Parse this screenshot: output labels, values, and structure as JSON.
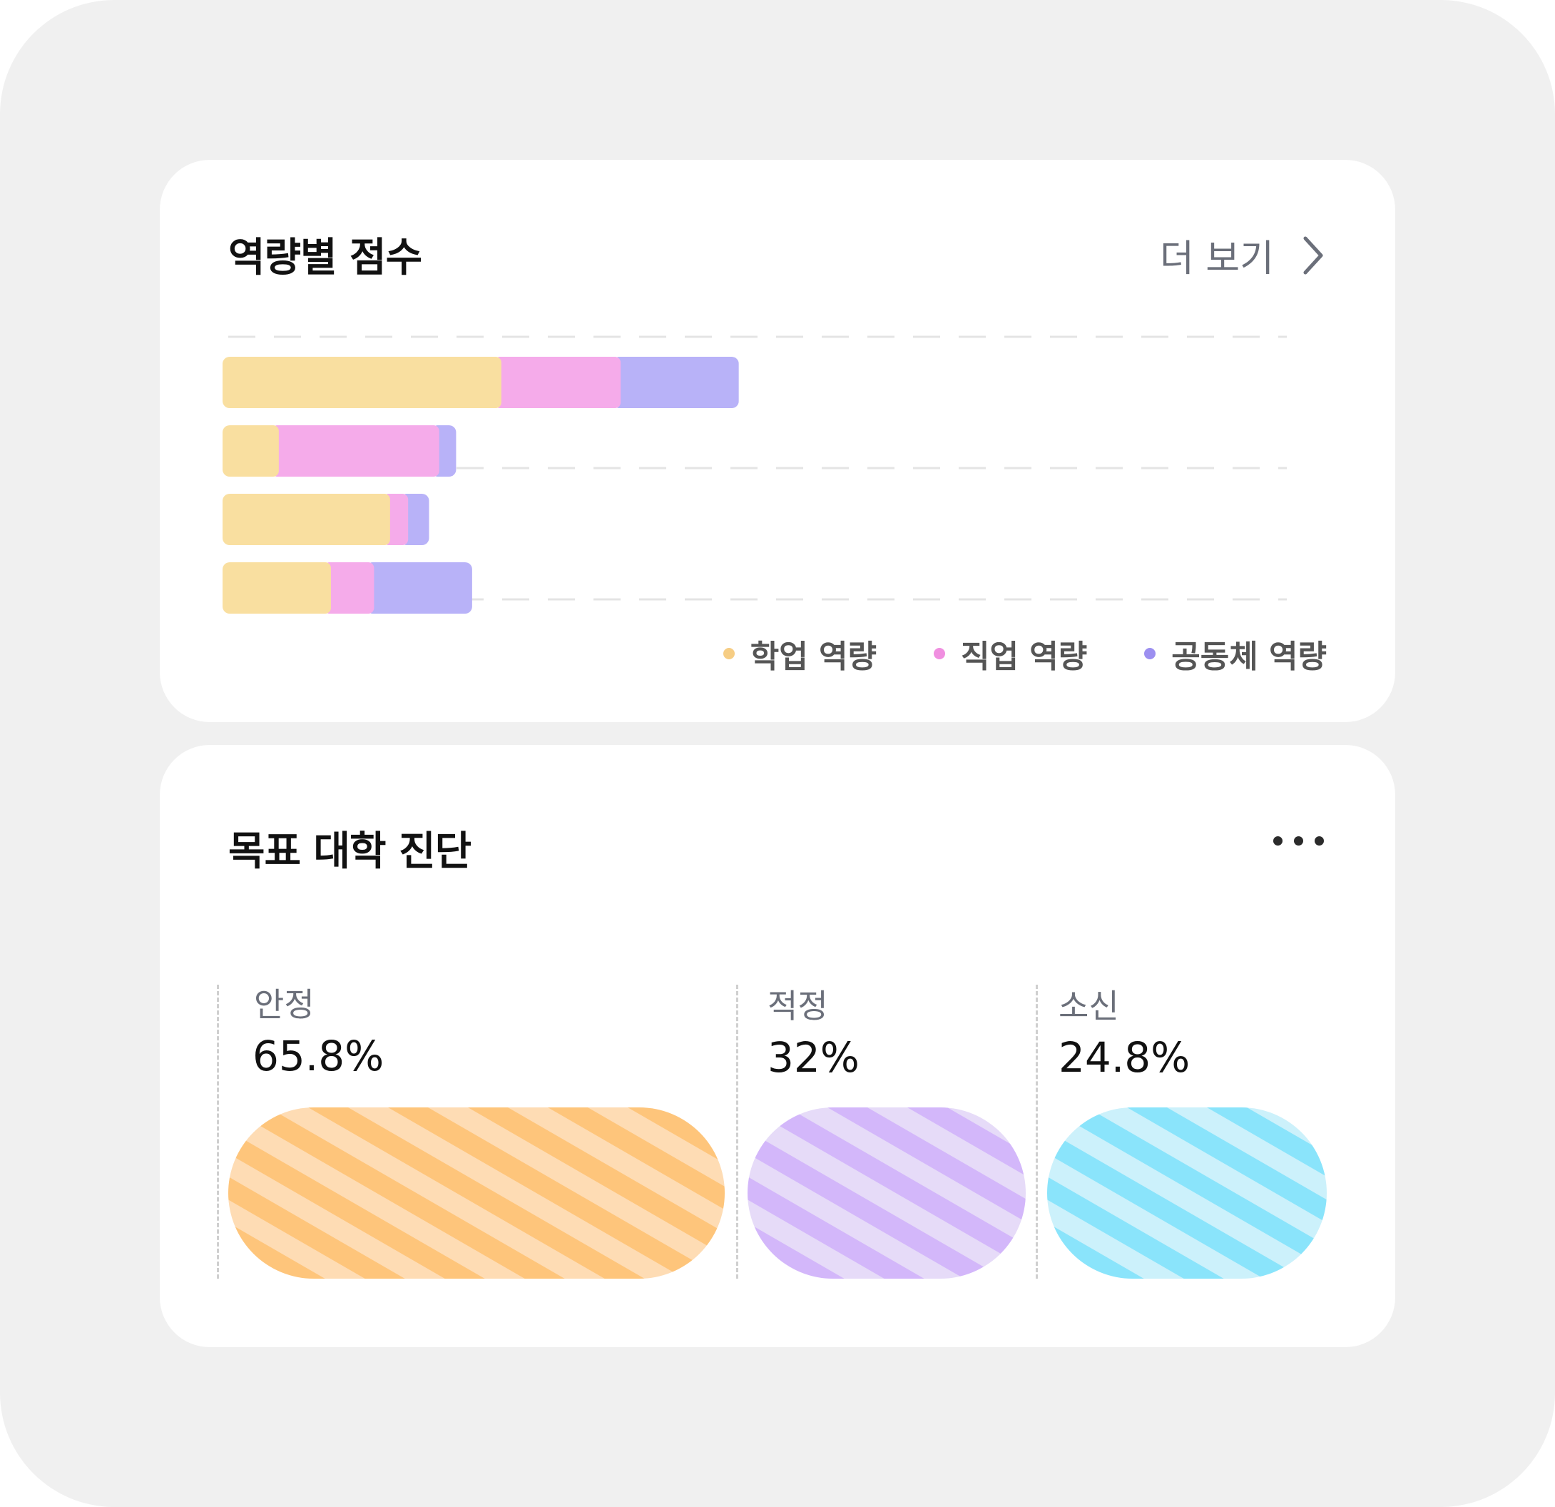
{
  "scores_card": {
    "title": "역량별 점수",
    "more_label": "더 보기",
    "legend": [
      {
        "label": "학업 역량",
        "color": "#f6cd84"
      },
      {
        "label": "직업 역량",
        "color": "#f08fe0"
      },
      {
        "label": "공동체 역량",
        "color": "#9c8ff0"
      }
    ]
  },
  "chart_data": {
    "type": "bar",
    "orientation": "horizontal",
    "stacked": true,
    "grid": true,
    "legend_position": "bottom-right",
    "series": [
      {
        "name": "학업 역량",
        "color": "#f9dfa0",
        "values": [
          271,
          49,
          160,
          101
        ]
      },
      {
        "name": "직업 역량",
        "color": "#f5abea",
        "values": [
          119,
          160,
          18,
          43
        ]
      },
      {
        "name": "공동체 역량",
        "color": "#b8b2f8",
        "values": [
          125,
          24,
          28,
          105
        ]
      }
    ],
    "xlim": [
      0,
      740
    ]
  },
  "target_card": {
    "title": "목표 대학 진단",
    "columns": [
      {
        "label": "안정",
        "value": "65.8%",
        "stripe_a": "#fec57b",
        "stripe_b": "#fedcb4"
      },
      {
        "label": "적정",
        "value": "32%",
        "stripe_a": "#d3b7fa",
        "stripe_b": "#e6dbf8"
      },
      {
        "label": "소신",
        "value": "24.8%",
        "stripe_a": "#8ae4fb",
        "stripe_b": "#ccf1fb"
      }
    ]
  }
}
